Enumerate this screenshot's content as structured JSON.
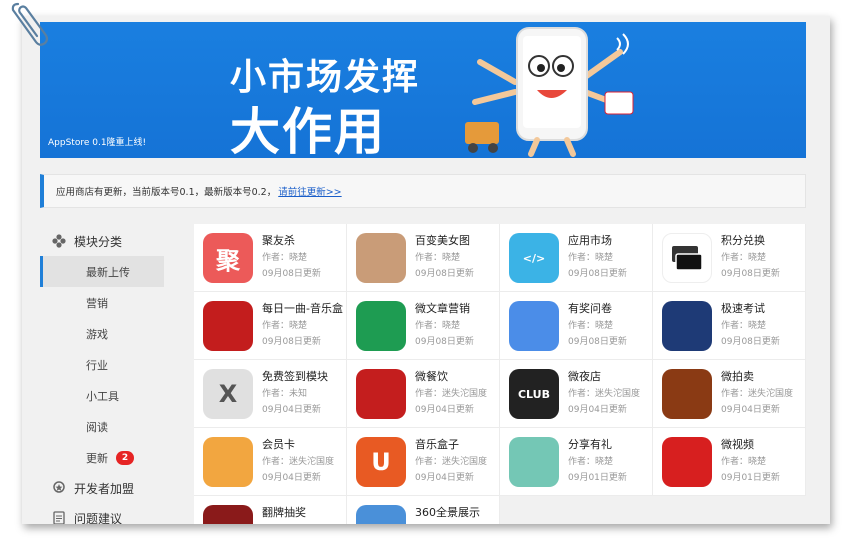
{
  "banner": {
    "line1": "小市场发挥",
    "line2": "大作用",
    "caption": "AppStore 0.1隆重上线!"
  },
  "notice": {
    "text": "应用商店有更新，当前版本号0.1，最新版本号0.2，",
    "link": "请前往更新>>"
  },
  "sidebar": {
    "section1": "模块分类",
    "items": [
      {
        "label": "最新上传"
      },
      {
        "label": "营销"
      },
      {
        "label": "游戏"
      },
      {
        "label": "行业"
      },
      {
        "label": "小工具"
      },
      {
        "label": "阅读"
      },
      {
        "label": "更新",
        "badge": "2"
      }
    ],
    "section2": "开发者加盟",
    "section3": "问题建议"
  },
  "apps": [
    {
      "name": "聚友杀",
      "author": "作者：晓楚",
      "date": "09月08日更新",
      "icon": "ju-icon",
      "color": "#ec5a59",
      "glyph": "聚"
    },
    {
      "name": "百变美女图",
      "author": "作者：晓楚",
      "date": "09月08日更新",
      "icon": "portrait-icon",
      "color": "#c99c78",
      "glyph": ""
    },
    {
      "name": "应用市场",
      "author": "作者：晓楚",
      "date": "09月08日更新",
      "icon": "code-icon",
      "color": "#3bb3e6",
      "glyph": "</>"
    },
    {
      "name": "积分兑换",
      "author": "作者：晓楚",
      "date": "09月08日更新",
      "icon": "cards-icon",
      "color": "#ffffff",
      "glyph": ""
    },
    {
      "name": "每日一曲-音乐盒",
      "author": "作者：晓楚",
      "date": "09月08日更新",
      "icon": "music-note-icon",
      "color": "#c31d1d",
      "glyph": ""
    },
    {
      "name": "微文章营销",
      "author": "作者：晓楚",
      "date": "09月08日更新",
      "icon": "share-icon",
      "color": "#1e9c52",
      "glyph": ""
    },
    {
      "name": "有奖问卷",
      "author": "作者：晓楚",
      "date": "09月08日更新",
      "icon": "checklist-icon",
      "color": "#4b8de8",
      "glyph": ""
    },
    {
      "name": "极速考试",
      "author": "作者：晓楚",
      "date": "09月08日更新",
      "icon": "pencil-icon",
      "color": "#1e3a76",
      "glyph": ""
    },
    {
      "name": "免费签到模块",
      "author": "作者：未知",
      "date": "09月04日更新",
      "icon": "x-circle-icon",
      "color": "#e0e0e0",
      "glyph": "X"
    },
    {
      "name": "微餐饮",
      "author": "作者：迷失沱国度",
      "date": "09月04日更新",
      "icon": "dining-icon",
      "color": "#c41e1e",
      "glyph": ""
    },
    {
      "name": "微夜店",
      "author": "作者：迷失沱国度",
      "date": "09月04日更新",
      "icon": "club-icon",
      "color": "#222222",
      "glyph": "CLUB"
    },
    {
      "name": "微拍卖",
      "author": "作者：迷失沱国度",
      "date": "09月04日更新",
      "icon": "auction-icon",
      "color": "#8a3a14",
      "glyph": ""
    },
    {
      "name": "会员卡",
      "author": "作者：迷失沱国度",
      "date": "09月04日更新",
      "icon": "member-card-icon",
      "color": "#f2a640",
      "glyph": ""
    },
    {
      "name": "音乐盒子",
      "author": "作者：迷失沱国度",
      "date": "09月04日更新",
      "icon": "headphones-icon",
      "color": "#e85a23",
      "glyph": "U"
    },
    {
      "name": "分享有礼",
      "author": "作者：晓楚",
      "date": "09月01日更新",
      "icon": "gift-icon",
      "color": "#74c7b5",
      "glyph": ""
    },
    {
      "name": "微视频",
      "author": "作者：晓楚",
      "date": "09月01日更新",
      "icon": "play-icon",
      "color": "#d71f1f",
      "glyph": ""
    },
    {
      "name": "翻牌抽奖",
      "author": "",
      "date": "",
      "icon": "card-flip-icon",
      "color": "#8a1a1a",
      "glyph": ""
    },
    {
      "name": "360全景展示",
      "author": "",
      "date": "",
      "icon": "panorama-icon",
      "color": "#4a90d9",
      "glyph": ""
    }
  ]
}
